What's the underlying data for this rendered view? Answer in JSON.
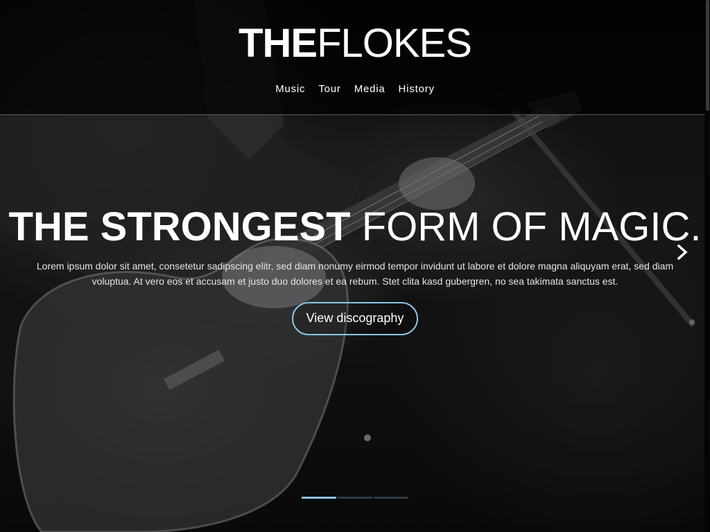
{
  "header": {
    "logo_bold": "THE",
    "logo_light": "FLOKES",
    "nav": [
      {
        "label": "Music"
      },
      {
        "label": "Tour"
      },
      {
        "label": "Media"
      },
      {
        "label": "History"
      }
    ]
  },
  "hero": {
    "title_bold": "THE STRONGEST",
    "title_light": "FORM OF MAGIC.",
    "body_line1": "Lorem ipsum dolor sit amet, consetetur sadipscing elitr, sed diam nonumy eirmod tempor invidunt ut labore et dolore magna aliquyam erat, sed diam",
    "body_line2": "voluptua. At vero eos et accusam et justo duo dolores et ea rebum. Stet clita kasd gubergren, no sea takimata sanctus est.",
    "button_label": "View discography",
    "next_icon": "chevron-right-icon"
  },
  "slider": {
    "slide_count": 3,
    "active_slide": 1
  },
  "colors": {
    "accent": "#8cc4e8",
    "pager_inactive": "#2b3a48",
    "header_bg": "#000000"
  }
}
